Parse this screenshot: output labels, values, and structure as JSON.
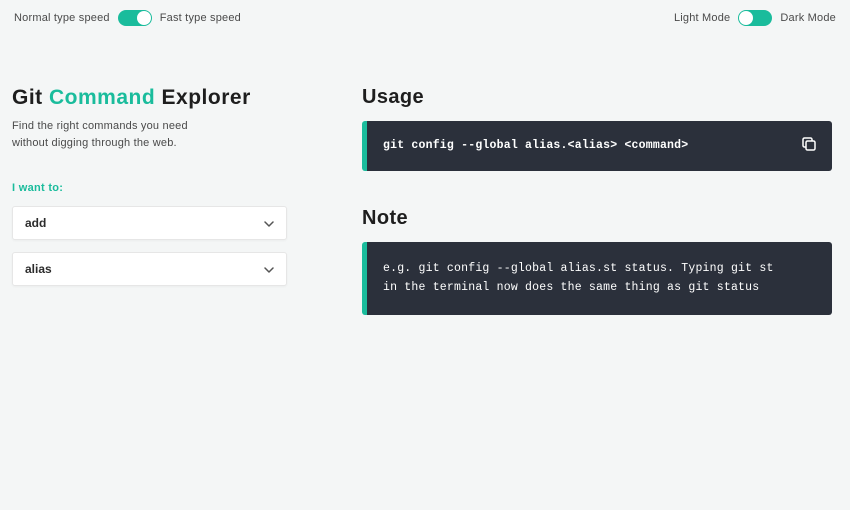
{
  "topbar": {
    "speed": {
      "left": "Normal type speed",
      "right": "Fast type speed"
    },
    "theme": {
      "left": "Light Mode",
      "right": "Dark Mode"
    }
  },
  "title": {
    "word1": "Git",
    "word2": "Command",
    "word3": "Explorer"
  },
  "description_line1": "Find the right commands you need",
  "description_line2": "without digging through the web.",
  "prompt": "I want to:",
  "selects": {
    "primary": "add",
    "secondary": "alias"
  },
  "usage": {
    "heading": "Usage",
    "command": "git config --global alias.<alias> <command>"
  },
  "note": {
    "heading": "Note",
    "text": "e.g. git config --global alias.st status. Typing git st in the terminal now does the same thing as git status"
  },
  "colors": {
    "accent": "#1abc9c",
    "code_bg": "#2b303b"
  }
}
